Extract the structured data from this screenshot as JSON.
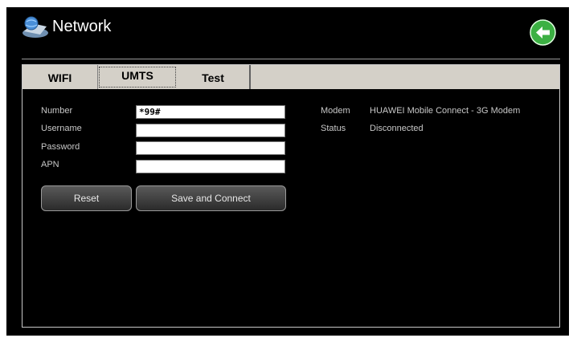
{
  "header": {
    "title": "Network",
    "app_icon": "network-folder-icon",
    "back_icon": "back-arrow-icon"
  },
  "tabs": [
    {
      "label": "WIFI",
      "active": false
    },
    {
      "label": "UMTS",
      "active": true
    },
    {
      "label": "Test",
      "active": false
    }
  ],
  "form": {
    "number": {
      "label": "Number",
      "value": "*99#"
    },
    "username": {
      "label": "Username",
      "value": ""
    },
    "password": {
      "label": "Password",
      "value": ""
    },
    "apn": {
      "label": "APN",
      "value": ""
    }
  },
  "buttons": {
    "reset": "Reset",
    "save_connect": "Save and Connect"
  },
  "info": {
    "modem_label": "Modem",
    "modem_value": "HUAWEI Mobile Connect - 3G Modem",
    "status_label": "Status",
    "status_value": "Disconnected"
  },
  "colors": {
    "background": "#000000",
    "tabbar": "#d4d0c8",
    "back_button": "#3cb043"
  }
}
